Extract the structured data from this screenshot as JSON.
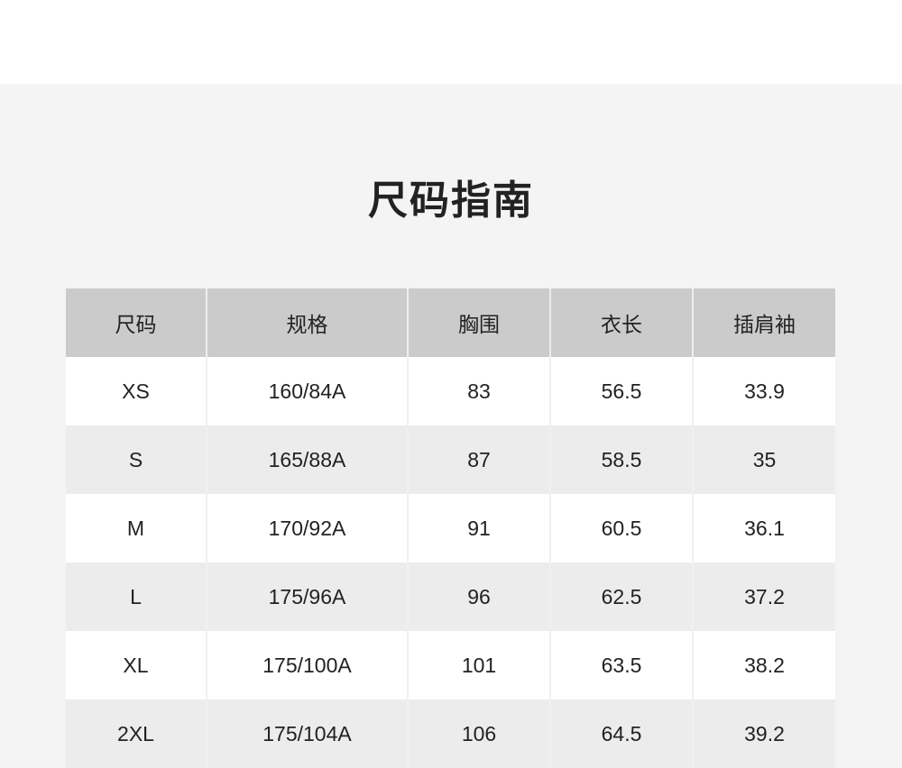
{
  "title": "尺码指南",
  "table": {
    "headers": [
      "尺码",
      "规格",
      "胸围",
      "衣长",
      "插肩袖"
    ],
    "rows": [
      [
        "XS",
        "160/84A",
        "83",
        "56.5",
        "33.9"
      ],
      [
        "S",
        "165/88A",
        "87",
        "58.5",
        "35"
      ],
      [
        "M",
        "170/92A",
        "91",
        "60.5",
        "36.1"
      ],
      [
        "L",
        "175/96A",
        "96",
        "62.5",
        "37.2"
      ],
      [
        "XL",
        "175/100A",
        "101",
        "63.5",
        "38.2"
      ],
      [
        "2XL",
        "175/104A",
        "106",
        "64.5",
        "39.2"
      ]
    ]
  },
  "colors": {
    "header_bg": "#cbcbcb",
    "panel_bg": "#f4f4f4",
    "row_alt_bg": "#ececec",
    "text": "#222222"
  }
}
